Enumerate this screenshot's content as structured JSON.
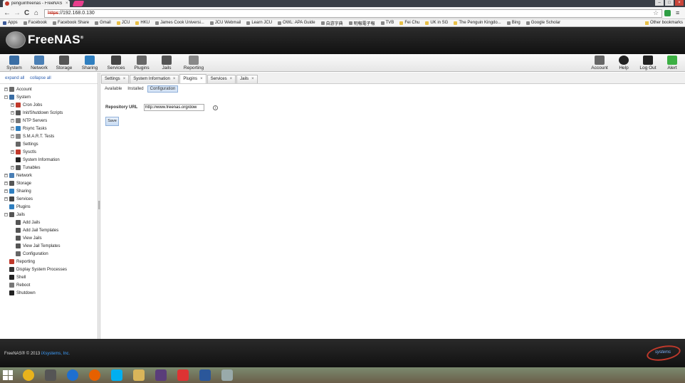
{
  "browser": {
    "tab_title": "penguinfreenas - FreeNAS",
    "tab_close": "×",
    "address_scheme": "https",
    "address_rest": "://192.168.0.130",
    "back": "←",
    "forward": "→",
    "reload": "C",
    "home": "⌂",
    "star": "☆",
    "menu": "≡",
    "win_min": "–",
    "win_max": "□",
    "win_close": "×",
    "bookmarks": [
      "Apps",
      "Facebook",
      "Facebook Share",
      "Gmail",
      "JCU",
      "HKU",
      "James Cook Universi...",
      "JCU Webmail",
      "Learn JCU",
      "OWL: APA Guide",
      "自游字典",
      "明報電子報",
      "TVB",
      "Fei Chu",
      "UK in SG",
      "The Penguin Kingdo...",
      "Bing",
      "Google Scholar"
    ],
    "other_bookmarks": "Other bookmarks"
  },
  "header": {
    "app_name": "FreeNAS",
    "trademark": "®"
  },
  "toolbar": {
    "left": [
      "System",
      "Network",
      "Storage",
      "Sharing",
      "Services",
      "Plugins",
      "Jails",
      "Reporting"
    ],
    "right": [
      "Account",
      "Help",
      "Log Out",
      "Alert"
    ],
    "colors": {
      "System": "#3a6ea5",
      "Network": "#4a7fb5",
      "Storage": "#555555",
      "Sharing": "#2f7fc0",
      "Services": "#444444",
      "Plugins": "#666666",
      "Jails": "#555555",
      "Reporting": "#888888",
      "Account": "#666666",
      "Help": "#222222",
      "Log Out": "#222222",
      "Alert": "#3cb043"
    }
  },
  "tree": {
    "expand_all": "expand all",
    "collapse_all": "collapse all",
    "items": [
      {
        "label": "Account",
        "indent": 0,
        "exp": "+",
        "color": "#6a6a6a"
      },
      {
        "label": "System",
        "indent": 0,
        "exp": "–",
        "color": "#3a6ea5"
      },
      {
        "label": "Cron Jobs",
        "indent": 1,
        "exp": "+",
        "color": "#c0392b"
      },
      {
        "label": "Init/Shutdown Scripts",
        "indent": 1,
        "exp": "+",
        "color": "#555555"
      },
      {
        "label": "NTP Servers",
        "indent": 1,
        "exp": "+",
        "color": "#777777"
      },
      {
        "label": "Rsync Tasks",
        "indent": 1,
        "exp": "+",
        "color": "#2f7fc0"
      },
      {
        "label": "S.M.A.R.T. Tests",
        "indent": 1,
        "exp": "+",
        "color": "#888888"
      },
      {
        "label": "Settings",
        "indent": 1,
        "exp": "",
        "color": "#666666"
      },
      {
        "label": "Sysctls",
        "indent": 1,
        "exp": "+",
        "color": "#c0392b"
      },
      {
        "label": "System Information",
        "indent": 1,
        "exp": "",
        "color": "#222222"
      },
      {
        "label": "Tunables",
        "indent": 1,
        "exp": "+",
        "color": "#555555"
      },
      {
        "label": "Network",
        "indent": 0,
        "exp": "+",
        "color": "#4a7fb5"
      },
      {
        "label": "Storage",
        "indent": 0,
        "exp": "+",
        "color": "#555555"
      },
      {
        "label": "Sharing",
        "indent": 0,
        "exp": "+",
        "color": "#2f7fc0"
      },
      {
        "label": "Services",
        "indent": 0,
        "exp": "+",
        "color": "#444444"
      },
      {
        "label": "Plugins",
        "indent": 0,
        "exp": "",
        "color": "#2f7fc0"
      },
      {
        "label": "Jails",
        "indent": 0,
        "exp": "–",
        "color": "#555555"
      },
      {
        "label": "Add Jails",
        "indent": 1,
        "exp": "",
        "color": "#555555"
      },
      {
        "label": "Add Jail Templates",
        "indent": 1,
        "exp": "",
        "color": "#555555"
      },
      {
        "label": "View Jails",
        "indent": 1,
        "exp": "",
        "color": "#555555"
      },
      {
        "label": "View Jail Templates",
        "indent": 1,
        "exp": "",
        "color": "#555555"
      },
      {
        "label": "Configuration",
        "indent": 1,
        "exp": "",
        "color": "#666666"
      },
      {
        "label": "Reporting",
        "indent": 0,
        "exp": "",
        "color": "#c0392b"
      },
      {
        "label": "Display System Processes",
        "indent": 0,
        "exp": "",
        "color": "#333333"
      },
      {
        "label": "Shell",
        "indent": 0,
        "exp": "",
        "color": "#222222"
      },
      {
        "label": "Reboot",
        "indent": 0,
        "exp": "",
        "color": "#777777"
      },
      {
        "label": "Shutdown",
        "indent": 0,
        "exp": "",
        "color": "#222222"
      }
    ]
  },
  "main": {
    "tabs": [
      {
        "label": "Settings",
        "active": false
      },
      {
        "label": "System Information",
        "active": false
      },
      {
        "label": "Plugins",
        "active": true
      },
      {
        "label": "Services",
        "active": false
      },
      {
        "label": "Jails",
        "active": false
      }
    ],
    "tab_close": "×",
    "subtabs": [
      {
        "label": "Available",
        "active": false
      },
      {
        "label": "Installed",
        "active": false
      },
      {
        "label": "Configuration",
        "active": true
      }
    ],
    "repo_label": "Repository URL",
    "repo_value": "http://www.freenas.org/dow",
    "info": "i",
    "save": "Save"
  },
  "footer": {
    "copyright_pre": "FreeNAS® © 2013 ",
    "copyright_link": "iXsystems, Inc.",
    "brand": "systems"
  },
  "taskbar": {
    "apps": [
      "chrome",
      "metro",
      "ie",
      "firefox",
      "skype",
      "explorer",
      "freesync",
      "download",
      "word",
      "misc"
    ],
    "colors": [
      "#e8b31c",
      "#555555",
      "#1e6fcf",
      "#e66000",
      "#00aff0",
      "#d9b55a",
      "#5a3d7a",
      "#d33",
      "#2b579a",
      "#9aa"
    ]
  }
}
